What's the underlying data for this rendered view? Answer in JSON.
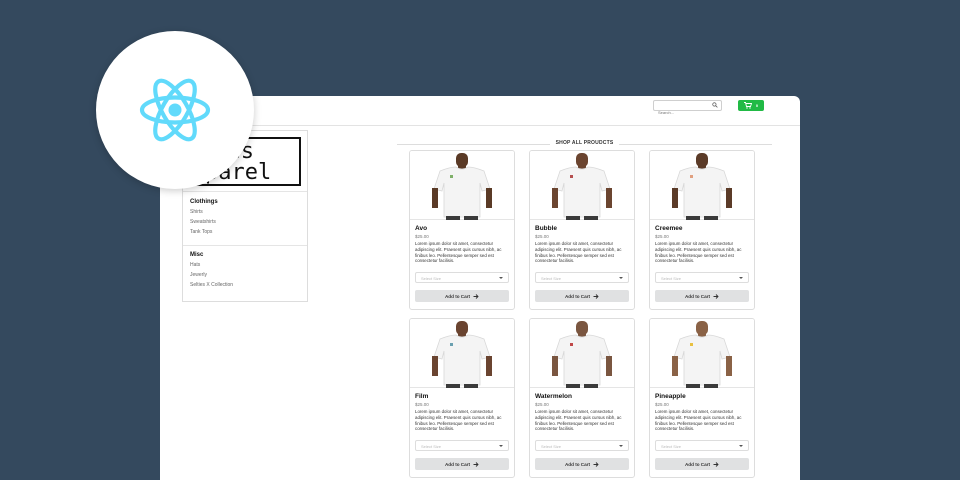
{
  "header": {
    "search_placeholder": "Search...",
    "cart_count": "0"
  },
  "logo": {
    "line1": "ties",
    "line2": "parel"
  },
  "sidebar": {
    "sections": [
      {
        "title": "Clothings",
        "items": [
          "Shirts",
          "Sweatshirts",
          "Tank Tops"
        ]
      },
      {
        "title": "Misc",
        "items": [
          "Hats",
          "Jewerly",
          "Selties X Collection"
        ]
      }
    ]
  },
  "main": {
    "title": "SHOP ALL PROUDCTS",
    "products": [
      {
        "name": "Avo",
        "price": "$25.00",
        "description": "Lorem ipsum dolor sit amet, consectetur adipiscing elit. Praesent quis cursus nibh, ac finibus leo. Pellentesque semper sed est consectetur facilisis.",
        "select_placeholder": "Select Size",
        "button": "Add to Cart"
      },
      {
        "name": "Bubble",
        "price": "$25.00",
        "description": "Lorem ipsum dolor sit amet, consectetur adipiscing elit. Praesent quis cursus nibh, ac finibus leo. Pellentesque semper sed est consectetur facilisis.",
        "select_placeholder": "Select Size",
        "button": "Add to Cart"
      },
      {
        "name": "Creemee",
        "price": "$25.00",
        "description": "Lorem ipsum dolor sit amet, consectetur adipiscing elit. Praesent quis cursus nibh, ac finibus leo. Pellentesque semper sed est consectetur facilisis.",
        "select_placeholder": "Select Size",
        "button": "Add to Cart"
      },
      {
        "name": "Film",
        "price": "$25.00",
        "description": "Lorem ipsum dolor sit amet, consectetur adipiscing elit. Praesent quis cursus nibh, ac finibus leo. Pellentesque semper sed est consectetur facilisis.",
        "select_placeholder": "Select Size",
        "button": "Add to Cart"
      },
      {
        "name": "Watermelon",
        "price": "$25.00",
        "description": "Lorem ipsum dolor sit amet, consectetur adipiscing elit. Praesent quis cursus nibh, ac finibus leo. Pellentesque semper sed est consectetur facilisis.",
        "select_placeholder": "Select Size",
        "button": "Add to Cart"
      },
      {
        "name": "Pineapple",
        "price": "$25.00",
        "description": "Lorem ipsum dolor sit amet, consectetur adipiscing elit. Praesent quis cursus nibh, ac finibus leo. Pellentesque semper sed est consectetur facilisis.",
        "select_placeholder": "Select Size",
        "button": "Add to Cart"
      }
    ]
  },
  "colors": {
    "background": "#34495e",
    "cart_button": "#21ba45",
    "react_logo": "#61dafb"
  },
  "icons": {
    "search": "search-icon",
    "cart": "cart-icon",
    "arrow": "arrow-right-icon",
    "react": "react-logo-icon"
  }
}
